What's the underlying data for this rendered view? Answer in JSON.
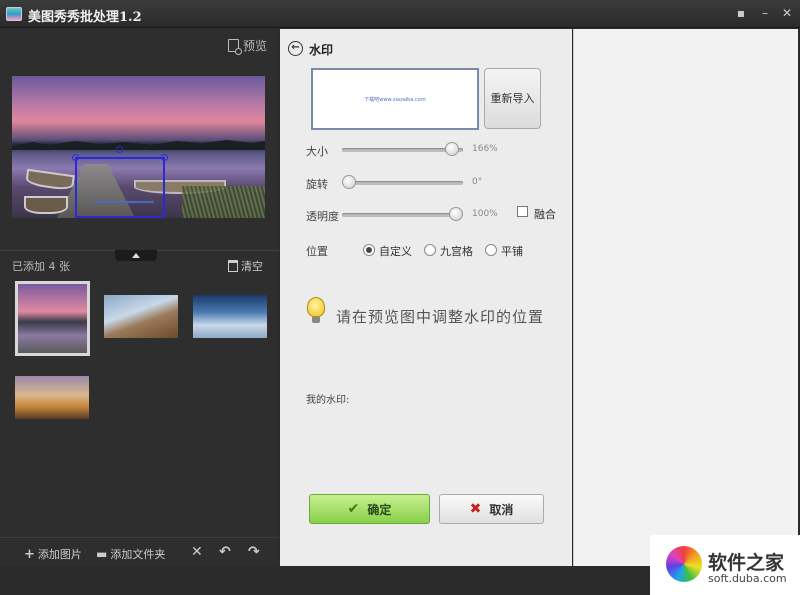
{
  "window": {
    "title": "美图秀秀批处理1.2",
    "controls": [
      "feedback-icon",
      "minimize-icon",
      "close-icon"
    ]
  },
  "left": {
    "preview_label": "预览",
    "count_label": "已添加 4 张",
    "clear_label": "清空",
    "thumbnails": [
      "lake-dock",
      "mountain-castle",
      "winter-city",
      "sunset-road"
    ],
    "selected_thumbnail": 0,
    "bottom": {
      "add_image": "添加图片",
      "add_folder": "添加文件夹",
      "actions": [
        "delete-icon",
        "rotate-left-icon",
        "rotate-right-icon"
      ]
    }
  },
  "watermark_panel": {
    "title": "水印",
    "preview_text": "下载吧www.xiazaiba.com",
    "reimport_label": "重新导入",
    "size_label": "大小",
    "size_value": "166%",
    "size_level": 0.96,
    "rotate_label": "旋转",
    "rotate_value": "0°",
    "rotate_level": 0.0,
    "opacity_label": "透明度",
    "opacity_value": "100%",
    "opacity_level": 1.0,
    "blend_label": "融合",
    "blend_checked": false,
    "position_label": "位置",
    "position_options": [
      "自定义",
      "九宫格",
      "平铺"
    ],
    "position_selected": "自定义",
    "hint": "请在预览图中调整水印的位置",
    "my_watermark_label": "我的水印:",
    "confirm_label": "确定",
    "cancel_label": "取消"
  },
  "badge": {
    "cn": "软件之家",
    "en": "soft.duba.com"
  }
}
